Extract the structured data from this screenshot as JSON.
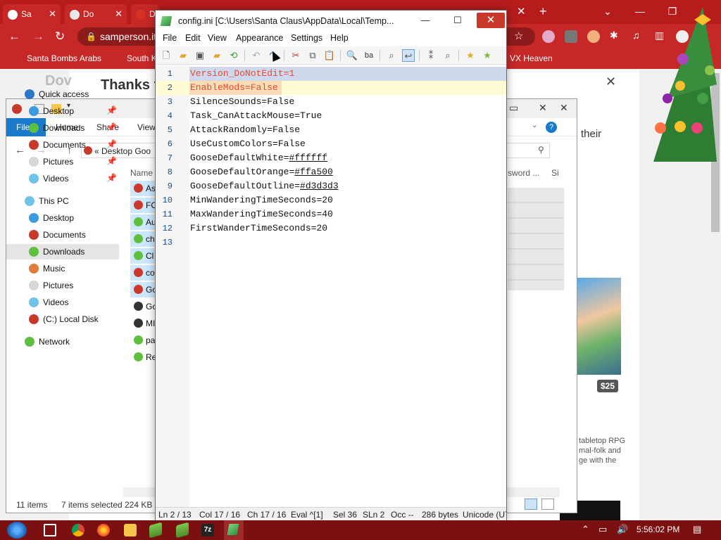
{
  "browser": {
    "tabs": [
      {
        "label": "Sa"
      },
      {
        "label": "Do"
      },
      {
        "label": "D"
      }
    ],
    "url": "samperson.it",
    "bookmarks": [
      "Santa Bombs Arabs",
      "South K",
      "VX Heaven"
    ]
  },
  "webpage": {
    "partial_heading": "Dov",
    "thanks": "Thanks f",
    "their": "their",
    "price": "$25",
    "description_lines": [
      "tabletop RPG",
      "mal-folk and",
      "ge with the"
    ]
  },
  "explorer": {
    "ribbon_tabs": [
      "File",
      "Home",
      "Share",
      "View"
    ],
    "address": "« Desktop Goo",
    "column_name": "Name",
    "right_col": "sword ...",
    "right_col2": "Si",
    "nav": [
      {
        "label": "Quick access",
        "color": "#2d77c7",
        "pinned": false
      },
      {
        "label": "Desktop",
        "color": "#3a9be0",
        "pinned": true
      },
      {
        "label": "Downloads",
        "color": "#5fbf3f",
        "pinned": true
      },
      {
        "label": "Documents",
        "color": "#c8392b",
        "pinned": true
      },
      {
        "label": "Pictures",
        "color": "#d8d8d8",
        "pinned": true
      },
      {
        "label": "Videos",
        "color": "#6fc3e8",
        "pinned": true
      },
      {
        "label": "This PC",
        "color": "#6fc3e8",
        "pinned": false
      },
      {
        "label": "Desktop",
        "color": "#3a9be0",
        "pinned": false
      },
      {
        "label": "Documents",
        "color": "#c8392b",
        "pinned": false
      },
      {
        "label": "Downloads",
        "color": "#5fbf3f",
        "pinned": false
      },
      {
        "label": "Music",
        "color": "#e07b39",
        "pinned": false
      },
      {
        "label": "Pictures",
        "color": "#d8d8d8",
        "pinned": false
      },
      {
        "label": "Videos",
        "color": "#6fc3e8",
        "pinned": false
      },
      {
        "label": "(C:) Local Disk",
        "color": "#c8392b",
        "pinned": false
      },
      {
        "label": "Network",
        "color": "#5fbf3f",
        "pinned": false
      }
    ],
    "files": [
      "As",
      "FC",
      "Au",
      "ch",
      "Cl",
      "co",
      "Go",
      "Go",
      "MI",
      "pa",
      "Re"
    ],
    "status": {
      "items": "11 items",
      "selected": "7 items selected",
      "size": "224 KB"
    }
  },
  "notepad": {
    "title": "config.ini [C:\\Users\\Santa Claus\\AppData\\Local\\Temp...",
    "menus": [
      "File",
      "Edit",
      "View",
      "Appearance",
      "Settings",
      "Help"
    ],
    "lines": [
      {
        "key": "Version_DoNotEdit",
        "value": "1"
      },
      {
        "key": "EnableMods",
        "value": "False"
      },
      {
        "key": "SilenceSounds",
        "value": "False"
      },
      {
        "key": "Task_CanAttackMouse",
        "value": "True"
      },
      {
        "key": "AttackRandomly",
        "value": "False"
      },
      {
        "key": "UseCustomColors",
        "value": "False"
      },
      {
        "key": "GooseDefaultWhite",
        "value": "#ffffff"
      },
      {
        "key": "GooseDefaultOrange",
        "value": "#ffa500"
      },
      {
        "key": "GooseDefaultOutline",
        "value": "#d3d3d3"
      },
      {
        "key": "MinWanderingTimeSeconds",
        "value": "20"
      },
      {
        "key": "MaxWanderingTimeSeconds",
        "value": "40"
      },
      {
        "key": "FirstWanderTimeSeconds",
        "value": "20"
      },
      {
        "key": "",
        "value": ""
      }
    ],
    "status": {
      "ln": "Ln 2 / 13",
      "col": "Col 17 / 16",
      "ch": "Ch 17 / 16",
      "eval": "Eval ^[1]",
      "sel": "Sel 36",
      "sln": "SLn 2",
      "occ": "Occ --",
      "bytes": "286 bytes",
      "encoding": "Unicode (UT"
    }
  },
  "taskbar": {
    "clock": "5:56:02 PM",
    "app_7z": "7z"
  }
}
